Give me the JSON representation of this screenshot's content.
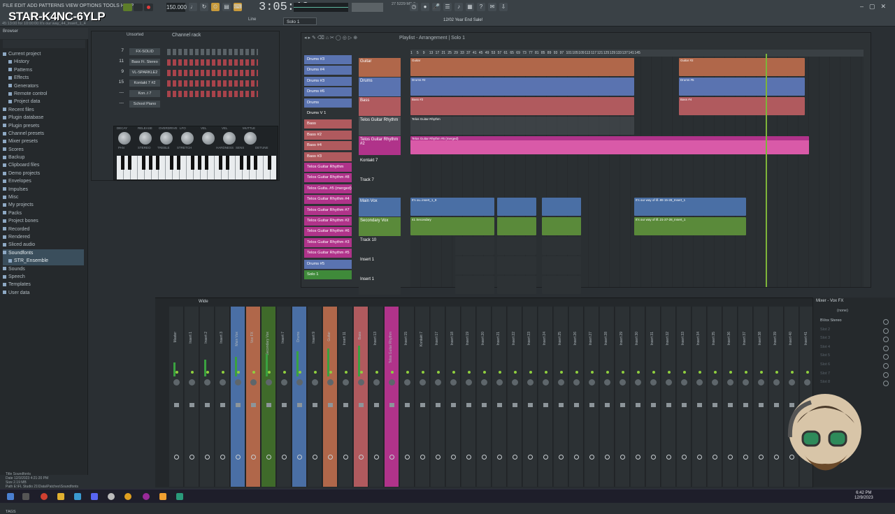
{
  "overlay_title": "STAR-K4NC-6YLP",
  "menu": [
    "FILE",
    "EDIT",
    "ADD",
    "PATTERNS",
    "VIEW",
    "OPTIONS",
    "TOOLS",
    "HELP"
  ],
  "song_info": "45:13:00 for 10:00:00    It's our way_44_Insert_1_4",
  "tempo": "150.000",
  "time": "3:05:46",
  "cpu": "27   5229 MB\n       2",
  "snap": "Line",
  "pattern_selector": "Solo 1",
  "news": "12/02  Year End Sale!",
  "browser": {
    "title": "Browser",
    "items": [
      {
        "label": "Current project",
        "sub": false,
        "sel": false
      },
      {
        "label": "History",
        "sub": true
      },
      {
        "label": "Patterns",
        "sub": true
      },
      {
        "label": "Effects",
        "sub": true
      },
      {
        "label": "Generators",
        "sub": true
      },
      {
        "label": "Remote control",
        "sub": true
      },
      {
        "label": "Project data",
        "sub": true
      },
      {
        "label": "Recent files",
        "sub": false
      },
      {
        "label": "Plugin database",
        "sub": false
      },
      {
        "label": "Plugin presets",
        "sub": false
      },
      {
        "label": "Channel presets",
        "sub": false
      },
      {
        "label": "Mixer presets",
        "sub": false
      },
      {
        "label": "Scores",
        "sub": false
      },
      {
        "label": "Backup",
        "sub": false
      },
      {
        "label": "Clipboard files",
        "sub": false
      },
      {
        "label": "Demo projects",
        "sub": false
      },
      {
        "label": "Envelopes",
        "sub": false
      },
      {
        "label": "Impulses",
        "sub": false
      },
      {
        "label": "Misc",
        "sub": false
      },
      {
        "label": "My projects",
        "sub": false
      },
      {
        "label": "Packs",
        "sub": false
      },
      {
        "label": "Project bones",
        "sub": false
      },
      {
        "label": "Recorded",
        "sub": false
      },
      {
        "label": "Rendered",
        "sub": false
      },
      {
        "label": "Sliced audio",
        "sub": false
      },
      {
        "label": "Soundfonts",
        "sub": false,
        "sel": true
      },
      {
        "label": "STR_Ensemble",
        "sub": true,
        "sel": true
      },
      {
        "label": "Sounds",
        "sub": false
      },
      {
        "label": "Speech",
        "sub": false
      },
      {
        "label": "Templates",
        "sub": false
      },
      {
        "label": "User data",
        "sub": false
      }
    ],
    "info": {
      "title": "Title   Soundfonts",
      "date": "Date    12/3/2023 4:21:20 PM",
      "size": "Size    2.19 MB",
      "path": "Path    E:\\FL Studio 21\\Data\\Patches\\Soundfonts"
    },
    "tags": "TAGS"
  },
  "channel_rack": {
    "title": "Channel rack",
    "group": "Unsorted",
    "channels": [
      {
        "num": "7",
        "name": "FX-SOLID",
        "color": "grey"
      },
      {
        "num": "11",
        "name": "Bass Fi. Stereo",
        "color": "red"
      },
      {
        "num": "9",
        "name": "VL-SPARKLE2",
        "color": "red"
      },
      {
        "num": "15",
        "name": "Kontakt 7 #2",
        "color": "red"
      },
      {
        "num": "---",
        "name": "Kon..t 7",
        "color": "red"
      },
      {
        "num": "---",
        "name": "School Piano",
        "color": "grey"
      }
    ],
    "synth_knobs": [
      "DECAY",
      "RELEASE",
      "OVERDRIVE",
      "LFO",
      "VEL",
      "VEL",
      "MUTTLE"
    ],
    "synth_labels2": [
      "PAN",
      "STEREO",
      "TREBLE",
      "STRETCH",
      "",
      "HARDNESS",
      "SENS",
      "DETUNE"
    ]
  },
  "playlist": {
    "title": "Playlist - Arrangement  |  Solo 1",
    "patterns": [
      {
        "label": "Drums #3",
        "color": "#5a73b0"
      },
      {
        "label": "Drums #4",
        "color": "#5a73b0"
      },
      {
        "label": "Drums #3",
        "color": "#5a73b0"
      },
      {
        "label": "Drums #6",
        "color": "#5a73b0"
      },
      {
        "label": "Drums",
        "color": "#5a73b0"
      },
      {
        "label": "Drums V 1",
        "color": "#2d3235"
      },
      {
        "label": "Bass",
        "color": "#b05a5e"
      },
      {
        "label": "Bass #2",
        "color": "#b05a5e"
      },
      {
        "label": "Bass #4",
        "color": "#b05a5e"
      },
      {
        "label": "Bass #3",
        "color": "#b05a5e"
      },
      {
        "label": "Telos Guitar Rhythm",
        "color": "#b0338a"
      },
      {
        "label": "Telos Guitar Rhythm #8",
        "color": "#b0338a"
      },
      {
        "label": "Telos Guita..#5 (merged)",
        "color": "#b0338a"
      },
      {
        "label": "Telos Guitar Rhythm #4",
        "color": "#b0338a"
      },
      {
        "label": "Telos Guitar Rhythm #7",
        "color": "#b0338a"
      },
      {
        "label": "Telos Guitar Rhythm #2",
        "color": "#b0338a"
      },
      {
        "label": "Telos Guitar Rhythm #6",
        "color": "#b0338a"
      },
      {
        "label": "Telos Guitar Rhythm #3",
        "color": "#b0338a"
      },
      {
        "label": "Telos Guitar Rhythm #5",
        "color": "#b0338a"
      },
      {
        "label": "Drums #5",
        "color": "#5a73b0"
      },
      {
        "label": "Solo 1",
        "color": "#3f8a3a"
      }
    ],
    "ruler": [
      "1",
      "3",
      "5",
      "7",
      "9",
      "11",
      "13",
      "15",
      "17",
      "19",
      "21",
      "23",
      "25",
      "27",
      "29",
      "31",
      "33",
      "35",
      "37",
      "39",
      "41",
      "43",
      "45",
      "47",
      "49",
      "51",
      "53",
      "55",
      "57",
      "59",
      "61",
      "63",
      "65",
      "67",
      "69",
      "71",
      "73",
      "75",
      "77",
      "79",
      "81",
      "83",
      "85",
      "87",
      "89",
      "91",
      "93",
      "95",
      "97",
      "99",
      "101",
      "103",
      "105",
      "107",
      "109",
      "111",
      "113",
      "115",
      "117",
      "119",
      "121",
      "123",
      "125",
      "127",
      "129",
      "131",
      "133",
      "135",
      "137",
      "139",
      "141",
      "143",
      "145"
    ],
    "tracks": [
      {
        "label": "Guitar",
        "color": "#b0674a",
        "clip": "Guitar",
        "clip2": "Guitar #2"
      },
      {
        "label": "Drums",
        "color": "#5a73b0",
        "clip": "Drums #2",
        "clip2": "Drums #5"
      },
      {
        "label": "Bass",
        "color": "#b05a5e",
        "clip": "Bass #2",
        "clip2": "Bass #4"
      },
      {
        "label": "Telos Guitar Rhythm",
        "color": "#4a4f53",
        "clip": "Telos Guitar Rhythm",
        "clip2": ""
      },
      {
        "label": "Telos Guitar Rhythm #2",
        "color": "#b0338a",
        "clip": "Telos Guitar Rhythm #5 (merged)",
        "clip2": ""
      },
      {
        "label": "Kontakt 7",
        "color": "#2d3235",
        "clip": "",
        "clip2": ""
      },
      {
        "label": "Track 7",
        "color": "#2d3235",
        "clip": "",
        "clip2": ""
      },
      {
        "label": "Main Vox",
        "color": "#4a6fa5",
        "clip": "It's ou..insert_1_8",
        "clip2": "It's our way of lif..89 15-28_Insert_1"
      },
      {
        "label": "Secondary Vox",
        "color": "#5a8a3a",
        "clip": "41 Secondary",
        "clip2": "It's our way of lif..21-27-28_Insert_1"
      },
      {
        "label": "Track 10",
        "color": "#2d3235",
        "clip": "",
        "clip2": ""
      },
      {
        "label": "Insert 1",
        "color": "#2d3235",
        "clip": "",
        "clip2": ""
      },
      {
        "label": "Insert 1",
        "color": "#2d3235",
        "clip": "",
        "clip2": ""
      }
    ]
  },
  "mixer": {
    "title": "Wide",
    "strips": [
      "Master",
      "Insert 1",
      "Insert 2",
      "Insert 3",
      "Main Vox",
      "Vox FX",
      "Secondary Vox",
      "Insert 7",
      "Drums",
      "Insert 9",
      "Guitar",
      "Insert 11",
      "Bass",
      "Insert 13",
      "Telos Guitar Rhythm",
      "Insert 15",
      "Kontakt 7",
      "Insert 17",
      "Insert 18",
      "Insert 19",
      "Insert 20",
      "Insert 21",
      "Insert 22",
      "Insert 23",
      "Insert 24",
      "Insert 25",
      "Insert 26",
      "Insert 27",
      "Insert 28",
      "Insert 29",
      "Insert 30",
      "Insert 31",
      "Insert 32",
      "Insert 33",
      "Insert 34",
      "Insert 35",
      "Insert 36",
      "Insert 37",
      "Insert 38",
      "Insert 39",
      "Insert 40",
      "Insert 41"
    ]
  },
  "mixer_fx": {
    "title": "Mixer - Vox FX",
    "input": "(none)",
    "slots": [
      "BVox Stereo",
      "Slot 2",
      "Slot 3",
      "Slot 4",
      "Slot 5",
      "Slot 6",
      "Slot 7",
      "Slot 8"
    ]
  },
  "clock": {
    "time": "6:42 PM",
    "date": "12/9/2023"
  },
  "colors": {
    "accent": "#7db53a",
    "drums": "#5a73b0",
    "bass": "#b05a5e",
    "telos": "#b0338a"
  }
}
